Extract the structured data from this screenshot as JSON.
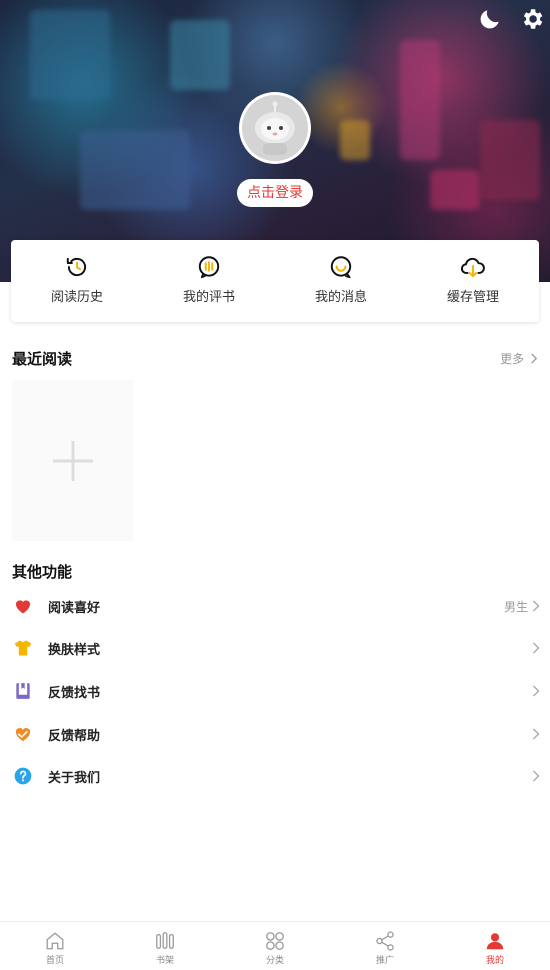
{
  "header": {
    "login_label": "点击登录",
    "icons": [
      "moon-icon",
      "gear-icon"
    ]
  },
  "quick_actions": [
    {
      "label": "阅读历史",
      "icon": "history-icon"
    },
    {
      "label": "我的评书",
      "icon": "review-icon"
    },
    {
      "label": "我的消息",
      "icon": "message-icon"
    },
    {
      "label": "缓存管理",
      "icon": "cloud-download-icon"
    }
  ],
  "recent": {
    "title": "最近阅读",
    "more_label": "更多"
  },
  "functions": {
    "title": "其他功能",
    "items": [
      {
        "label": "阅读喜好",
        "value": "男生",
        "icon": "heart-icon",
        "color": "#e53935"
      },
      {
        "label": "换肤样式",
        "value": "",
        "icon": "shirt-icon",
        "color": "#f5b400"
      },
      {
        "label": "反馈找书",
        "value": "",
        "icon": "book-icon",
        "color": "#7b68c8"
      },
      {
        "label": "反馈帮助",
        "value": "",
        "icon": "help-hands-icon",
        "color": "#f08a24"
      },
      {
        "label": "关于我们",
        "value": "",
        "icon": "question-icon",
        "color": "#29a4e8"
      }
    ]
  },
  "tabbar": {
    "active_color": "#e53935",
    "tabs": [
      {
        "label": "首页",
        "icon": "home-icon",
        "active": false
      },
      {
        "label": "书架",
        "icon": "bookshelf-icon",
        "active": false
      },
      {
        "label": "分类",
        "icon": "category-icon",
        "active": false
      },
      {
        "label": "推广",
        "icon": "share-icon",
        "active": false
      },
      {
        "label": "我的",
        "icon": "user-icon",
        "active": true
      }
    ]
  }
}
